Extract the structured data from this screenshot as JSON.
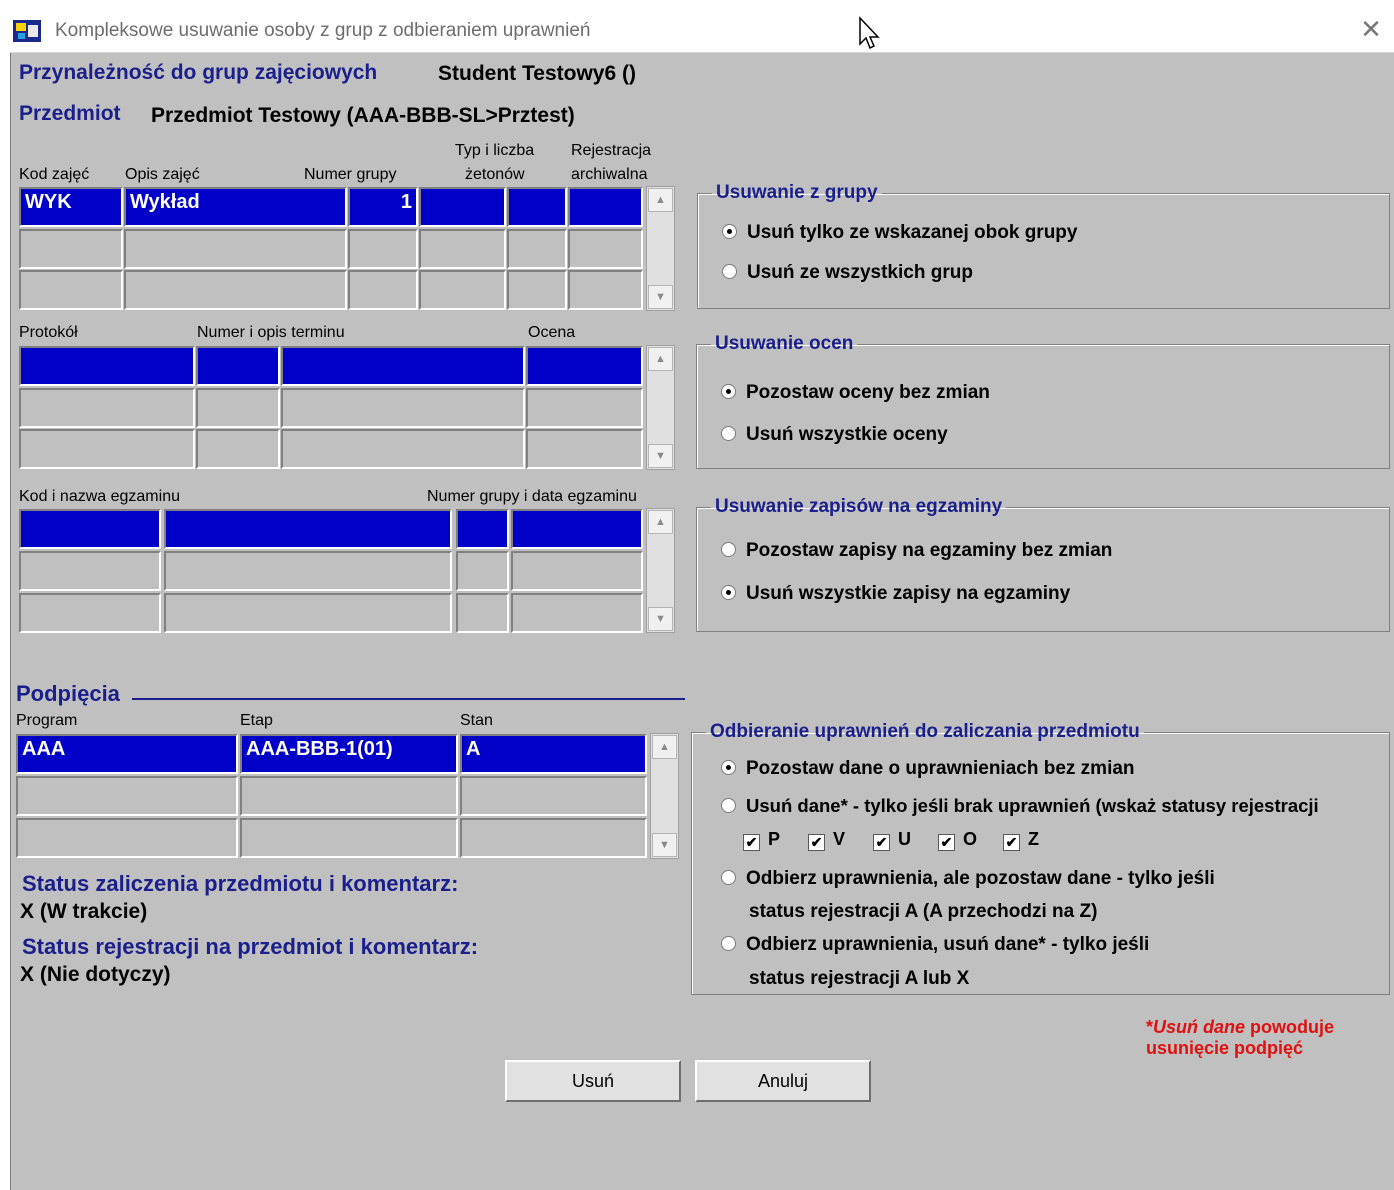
{
  "window": {
    "title": "Kompleksowe usuwanie osoby z grup z odbieraniem uprawnień",
    "close_glyph": "✕"
  },
  "header": {
    "group_label": "Przynależność do grup zajęciowych",
    "student": "Student Testowy6 ()",
    "subject_label": "Przedmiot",
    "subject": "Przedmiot Testowy (AAA-BBB-SL>Prztest)"
  },
  "groups_table": {
    "col_kod": "Kod zajęć",
    "col_opis": "Opis zajęć",
    "col_numer": "Numer grupy",
    "col_typ_1": "Typ i liczba",
    "col_typ_2": "żetonów",
    "col_rej_1": "Rejestracja",
    "col_rej_2": "archiwalna",
    "row1": {
      "kod": "WYK",
      "opis": "Wykład",
      "numer": "1"
    }
  },
  "protocol_table": {
    "col_protokol": "Protokół",
    "col_termin": "Numer i opis terminu",
    "col_ocena": "Ocena"
  },
  "exam_table": {
    "col_kod": "Kod i nazwa egzaminu",
    "col_numer": "Numer grupy i data egzaminu"
  },
  "podpiecia": {
    "title": "Podpięcia",
    "col_program": "Program",
    "col_etap": "Etap",
    "col_stan": "Stan",
    "row1": {
      "program": "AAA",
      "etap": "AAA-BBB-1(01)",
      "stan": "A"
    }
  },
  "status": {
    "zal_label": "Status zaliczenia przedmiotu i komentarz:",
    "zal_value": "X (W trakcie)",
    "rej_label": "Status rejestracji na przedmiot i komentarz:",
    "rej_value": "X (Nie dotyczy)"
  },
  "remove_group": {
    "legend": "Usuwanie z grupy",
    "opt1": "Usuń tylko ze wskazanej obok grupy",
    "opt2": "Usuń ze wszystkich grup",
    "selected": 1
  },
  "remove_grades": {
    "legend": "Usuwanie ocen",
    "opt1": "Pozostaw oceny bez zmian",
    "opt2": "Usuń wszystkie oceny",
    "selected": 1
  },
  "remove_exams": {
    "legend": "Usuwanie zapisów na egzaminy",
    "opt1": "Pozostaw zapisy na egzaminy bez zmian",
    "opt2": "Usuń wszystkie zapisy na egzaminy",
    "selected": 2
  },
  "revoke": {
    "legend": "Odbieranie uprawnień do zaliczania przedmiotu",
    "opt1": "Pozostaw dane o uprawnieniach bez zmian",
    "opt2": "Usuń dane* - tylko jeśli brak uprawnień (wskaż statusy rejestracji",
    "opt3_line1": "Odbierz uprawnienia, ale pozostaw dane - tylko jeśli",
    "opt3_line2": "status rejestracji A (A przechodzi na Z)",
    "opt4_line1": "Odbierz uprawnienia, usuń dane* - tylko jeśli",
    "opt4_line2": "status rejestracji A lub X",
    "selected": 1,
    "checkboxes": [
      {
        "label": "P",
        "checked": true
      },
      {
        "label": "V",
        "checked": true
      },
      {
        "label": "U",
        "checked": true
      },
      {
        "label": "O",
        "checked": true
      },
      {
        "label": "Z",
        "checked": true
      }
    ]
  },
  "note": {
    "star": "*",
    "italic": "Usuń dane",
    "rest1": " powoduje",
    "rest2": "usunięcie podpięć"
  },
  "buttons": {
    "delete": "Usuń",
    "cancel": "Anuluj"
  }
}
